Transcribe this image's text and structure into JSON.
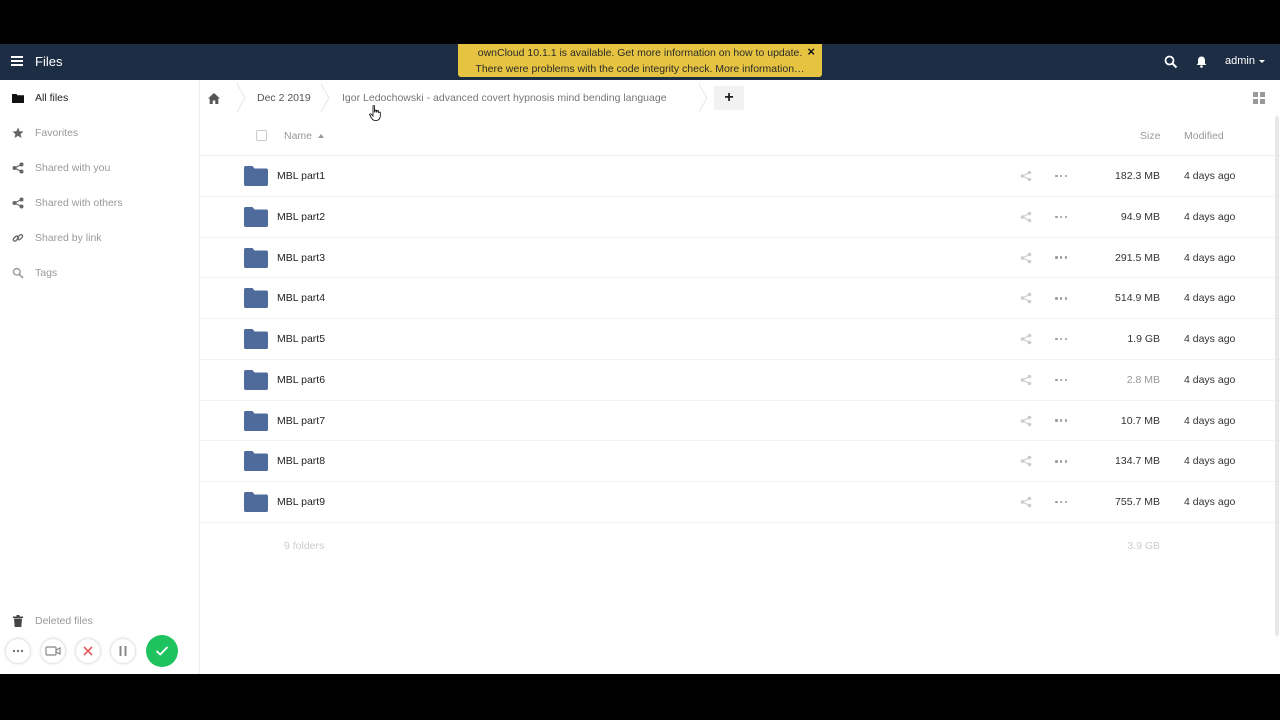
{
  "header": {
    "app_title": "Files",
    "user": "admin"
  },
  "notification": {
    "line1": "ownCloud 10.1.1 is available. Get more information on how to update.",
    "line2": "There were problems with the code integrity check. More information…",
    "close": "×"
  },
  "sidebar": {
    "items": [
      {
        "label": "All files",
        "icon": "folder-icon"
      },
      {
        "label": "Favorites",
        "icon": "star-icon"
      },
      {
        "label": "Shared with you",
        "icon": "share-icon"
      },
      {
        "label": "Shared with others",
        "icon": "share-icon"
      },
      {
        "label": "Shared by link",
        "icon": "link-icon"
      },
      {
        "label": "Tags",
        "icon": "tag-icon"
      }
    ],
    "deleted": "Deleted files"
  },
  "breadcrumb": {
    "items": [
      "Dec 2 2019",
      "Igor Ledochowski - advanced covert hypnosis mind bending language"
    ],
    "add": "+"
  },
  "table": {
    "col_name": "Name",
    "col_size": "Size",
    "col_modified": "Modified",
    "rows": [
      {
        "name": "MBL part1",
        "size": "182.3 MB",
        "modified": "4 days ago"
      },
      {
        "name": "MBL part2",
        "size": "94.9 MB",
        "modified": "4 days ago"
      },
      {
        "name": "MBL part3",
        "size": "291.5 MB",
        "modified": "4 days ago"
      },
      {
        "name": "MBL part4",
        "size": "514.9 MB",
        "modified": "4 days ago"
      },
      {
        "name": "MBL part5",
        "size": "1.9 GB",
        "modified": "4 days ago"
      },
      {
        "name": "MBL part6",
        "size": "2.8 MB",
        "modified": "4 days ago"
      },
      {
        "name": "MBL part7",
        "size": "10.7 MB",
        "modified": "4 days ago"
      },
      {
        "name": "MBL part8",
        "size": "134.7 MB",
        "modified": "4 days ago"
      },
      {
        "name": "MBL part9",
        "size": "755.7 MB",
        "modified": "4 days ago"
      }
    ],
    "summary_count": "9 folders",
    "summary_size": "3.9 GB"
  },
  "colors": {
    "header_bg": "#1d2d44",
    "folder": "#4e6b9c",
    "notification_bg": "#e6c441",
    "ok_green": "#1ec25e"
  }
}
